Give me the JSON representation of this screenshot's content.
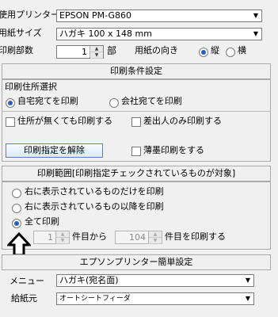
{
  "printer": {
    "label": "使用プリンター",
    "value": "EPSON PM-G860"
  },
  "paper_size": {
    "label": "用紙サイズ",
    "value": "ハガキ 100 x 148 mm"
  },
  "copies": {
    "label": "印刷部数",
    "value": "1",
    "unit": "部"
  },
  "orientation": {
    "label": "用紙の向き",
    "portrait": "縦",
    "landscape": "横",
    "selected": "縦"
  },
  "print_settings": {
    "header": "印刷条件設定",
    "address_group_label": "印刷住所選択",
    "home_label": "自宅宛てを印刷",
    "company_label": "会社宛てを印刷",
    "no_address_label": "住所が無くても印刷する",
    "sender_only_label": "差出人のみ印刷する",
    "clear_button": "印刷指定を解除",
    "light_ink_label": "薄墨印刷をする"
  },
  "print_range": {
    "header": "印刷範囲[印刷指定チェックされているものが対象]",
    "option_shown_only": "右に表示されているものだけを印刷",
    "option_from_shown": "右に表示されているもの以降を印刷",
    "option_all": "全て印刷",
    "from_value": "1",
    "from_suffix": "件目から",
    "to_value": "104",
    "to_suffix": "件目を印刷する"
  },
  "epson_simple": {
    "header": "エプソンプリンター簡単設定",
    "menu_label": "メニュー",
    "menu_value": "ハガキ(宛名面)",
    "feed_label": "給紙元",
    "feed_value": "オートシートフィーダ"
  }
}
